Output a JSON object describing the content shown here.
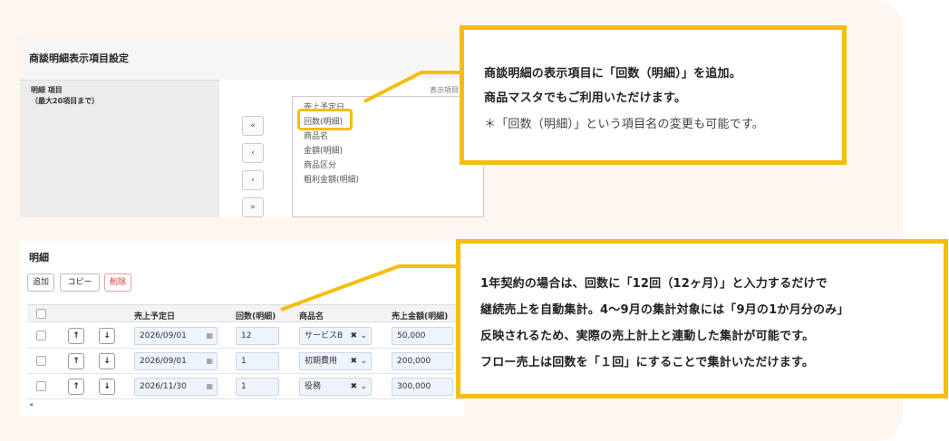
{
  "top_panel": {
    "title": "商談明細表示項目設定",
    "left_label_1": "明細 項目",
    "left_label_2": "（最大20項目まで）",
    "list_caption": "表示項目",
    "list_items": [
      "売上予定日",
      "回数(明細)",
      "商品名",
      "金額(明細)",
      "商品区分",
      "粗利金額(明細)"
    ],
    "move_buttons": [
      "«",
      "‹",
      "›",
      "»"
    ]
  },
  "bottom_panel": {
    "title": "明細",
    "buttons": {
      "add": "追加",
      "copy": "コピー",
      "delete": "削除"
    },
    "columns": [
      "売上予定日",
      "回数(明細)",
      "商品名",
      "売上金額(明細)"
    ],
    "move_up": "↑",
    "move_down": "↓",
    "rows": [
      {
        "date": "2026/09/01",
        "count": "12",
        "product": "サービスB",
        "amount": "50,000"
      },
      {
        "date": "2026/09/01",
        "count": "1",
        "product": "初期費用",
        "amount": "200,000"
      },
      {
        "date": "2026/11/30",
        "count": "1",
        "product": "役務",
        "amount": "300,000"
      }
    ],
    "scroll_left": "◂"
  },
  "callout_1": {
    "line1": "商談明細の表示項目に「回数（明細）」を追加。",
    "line2": "商品マスタでもご利用いただけます。",
    "line3": "＊「回数（明細）」という項目名の変更も可能です。"
  },
  "callout_2": {
    "line1": "1年契約の場合は、回数に「12回（12ヶ月）」と入力するだけで",
    "line2": "継続売上を自動集計。4〜9月の集計対象には「9月の1か月分のみ」",
    "line3": "反映されるため、実際の売上計上と連動した集計が可能です。",
    "line4": "フロー売上は回数を「１回」にすることで集計いただけます。"
  },
  "colors": {
    "accent": "#f5bd10",
    "background": "#fdf6f1",
    "danger": "#dd3333"
  }
}
